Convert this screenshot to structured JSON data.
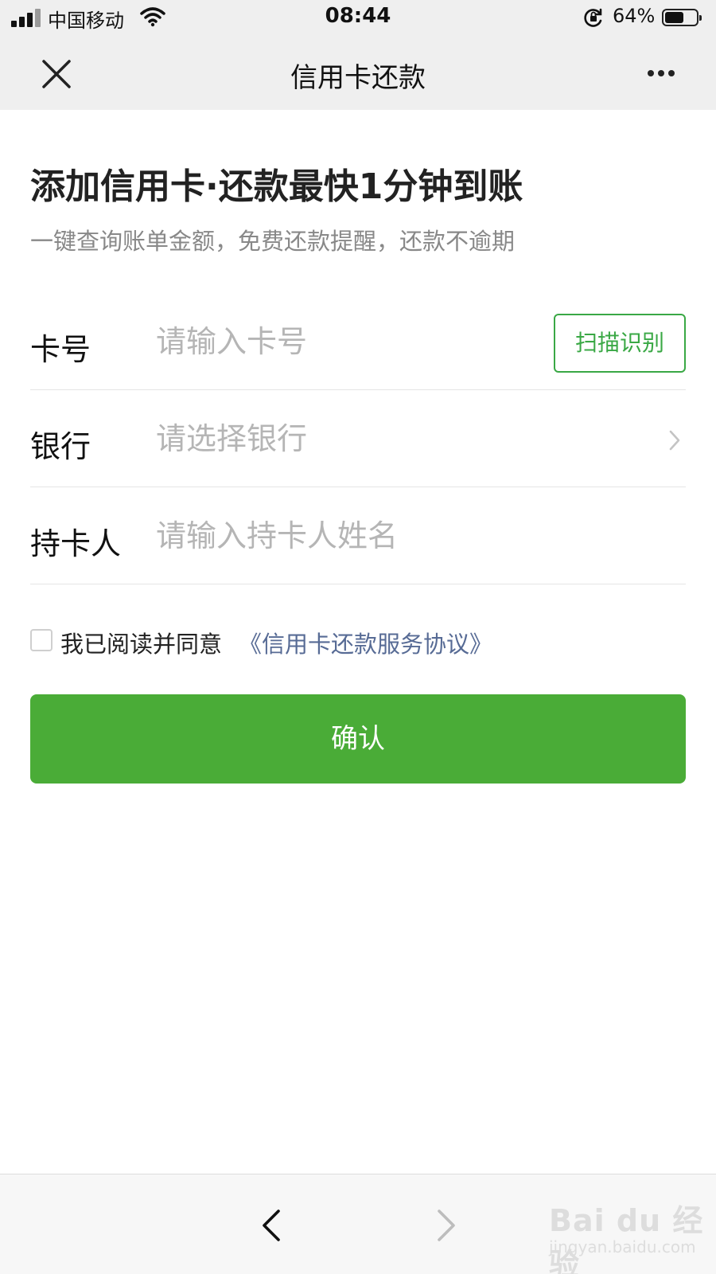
{
  "status_bar": {
    "carrier": "中国移动",
    "time": "08:44",
    "battery_percent": "64%",
    "battery_level": 0.64
  },
  "nav": {
    "title": "信用卡还款",
    "close_icon": "close-icon",
    "more_icon": "more-icon"
  },
  "headline": "添加信用卡·还款最快1分钟到账",
  "subline": "一键查询账单金额，免费还款提醒，还款不逾期",
  "form": {
    "card_number": {
      "label": "卡号",
      "placeholder": "请输入卡号",
      "value": "",
      "scan_label": "扫描识别"
    },
    "bank": {
      "label": "银行",
      "placeholder": "请选择银行",
      "value": ""
    },
    "holder": {
      "label": "持卡人",
      "placeholder": "请输入持卡人姓名",
      "value": ""
    }
  },
  "agreement": {
    "text": "我已阅读并同意",
    "link": "《信用卡还款服务协议》",
    "checked": false
  },
  "confirm_label": "确认",
  "toolbar": {
    "back_icon": "chevron-left-icon",
    "forward_icon": "chevron-right-icon"
  },
  "watermark": {
    "logo": "Bai du 经验",
    "url": "jingyan.baidu.com"
  },
  "colors": {
    "accent_green": "#4aac37",
    "scan_green": "#3aa845",
    "link_blue": "#576b95",
    "nav_bg": "#efefef",
    "placeholder": "#b5b5b5"
  }
}
